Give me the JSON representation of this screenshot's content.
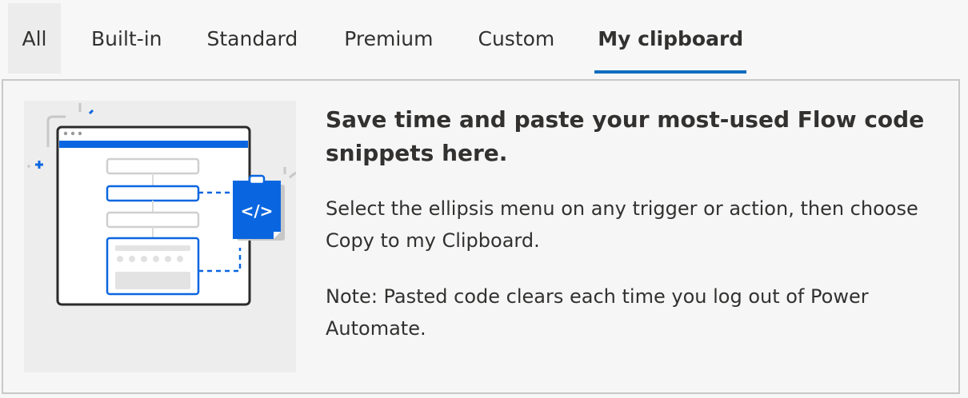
{
  "tabs": [
    {
      "label": "All",
      "selected": false
    },
    {
      "label": "Built-in",
      "selected": false
    },
    {
      "label": "Standard",
      "selected": false
    },
    {
      "label": "Premium",
      "selected": false
    },
    {
      "label": "Custom",
      "selected": false
    },
    {
      "label": "My clipboard",
      "selected": true
    }
  ],
  "clipboard": {
    "headline": "Save time and paste your most-used Flow code snippets here.",
    "description": "Select the ellipsis menu on any trigger or action, then choose Copy to my Clipboard.",
    "note": "Note: Pasted code clears each time you log out of Power Automate.",
    "illustration_icon": "clipboard-code-icon",
    "code_glyph": "</>"
  },
  "colors": {
    "accent": "#0f6cbd",
    "illustration_blue": "#0a66e0",
    "text": "#323130",
    "panel_border": "#c8c8c8"
  }
}
